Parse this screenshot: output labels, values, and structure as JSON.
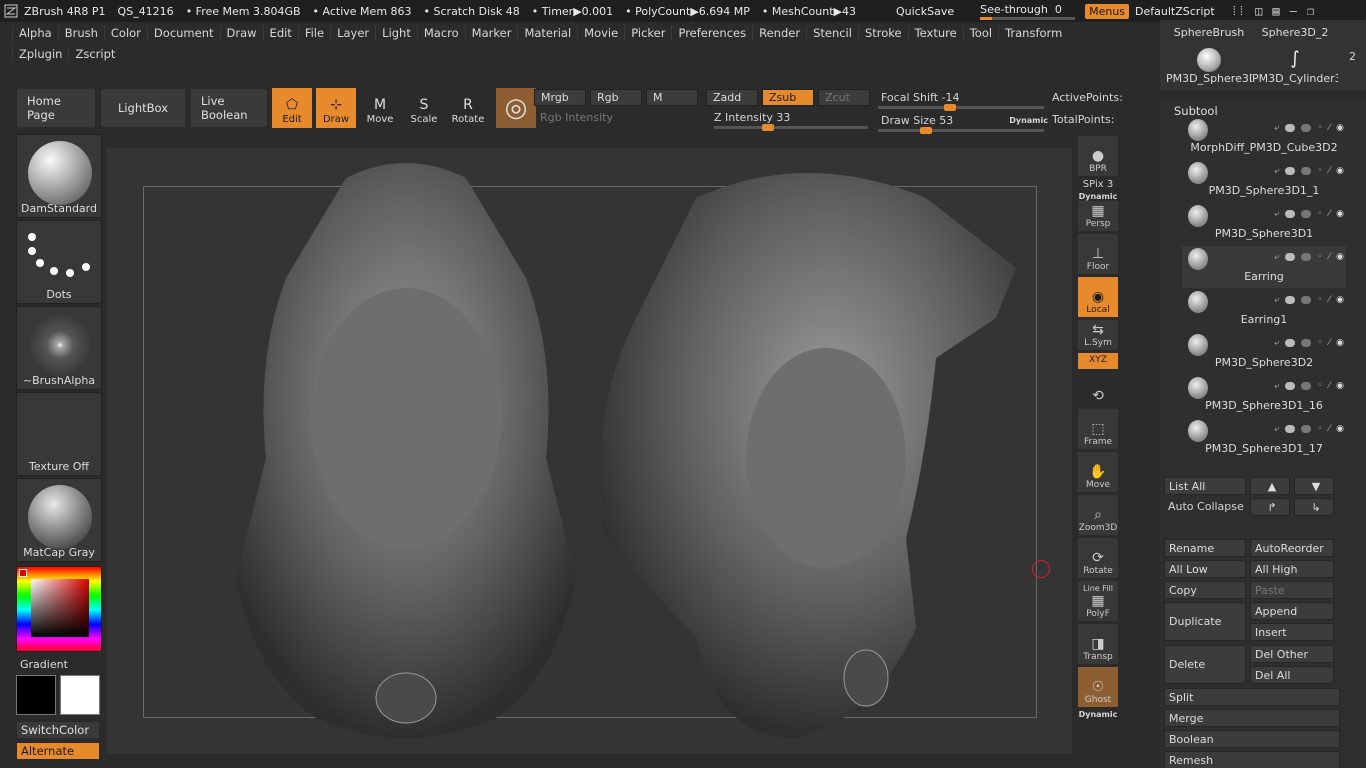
{
  "titlebar": {
    "app": "ZBrush 4R8 P1",
    "file": "QS_41216",
    "free_mem": "• Free Mem 3.804GB",
    "active_mem": "• Active Mem 863",
    "scratch": "• Scratch Disk 48",
    "timer": "• Timer▶0.001",
    "polycount": "• PolyCount▶6.694 MP",
    "meshcount": "• MeshCount▶43",
    "quicksave": "QuickSave",
    "see_through_label": "See-through",
    "see_through_value": "0",
    "see_through_level": 0,
    "menus": "Menus",
    "zscript": "DefaultZScript"
  },
  "menus": {
    "row1": [
      "Alpha",
      "Brush",
      "Color",
      "Document",
      "Draw",
      "Edit",
      "File",
      "Layer",
      "Light",
      "Macro",
      "Marker",
      "Material",
      "Movie",
      "Picker",
      "Preferences",
      "Render",
      "Stencil",
      "Stroke",
      "Texture",
      "Tool",
      "Transform"
    ],
    "row2": [
      "Zplugin",
      "Zscript"
    ]
  },
  "quickbar": {
    "home": "Home Page",
    "lightbox": "LightBox",
    "live_boolean": "Live Boolean",
    "edit": "Edit",
    "draw": "Draw",
    "move": "Move",
    "scale": "Scale",
    "rotate": "Rotate"
  },
  "params": {
    "mrgb": "Mrgb",
    "rgb": "Rgb",
    "m": "M",
    "rgb_intensity": "Rgb Intensity",
    "zadd": "Zadd",
    "zsub": "Zsub",
    "zcut": "Zcut",
    "z_intensity": "Z Intensity 33",
    "z_intensity_level": 0.33,
    "focal_shift": "Focal Shift -14",
    "focal_shift_level": 0.43,
    "draw_size": "Draw Size 53",
    "draw_size_level": 0.27,
    "dynamic": "Dynamic",
    "active_points": "ActivePoints:",
    "total_points": "TotalPoints:"
  },
  "leftshelf": {
    "brush": "DamStandard",
    "stroke": "Dots",
    "alpha": "~BrushAlpha",
    "texture": "Texture Off",
    "material": "MatCap Gray",
    "gradient": "Gradient",
    "switch_color": "SwitchColor",
    "alternate": "Alternate"
  },
  "rightshelf": {
    "bpr": "BPR",
    "spix": "SPix 3",
    "dynamic": "Dynamic",
    "persp": "Persp",
    "floor": "Floor",
    "local": "Local",
    "lsym": "L.Sym",
    "xyz": "XYZ",
    "frame": "Frame",
    "move": "Move",
    "zoom3d": "Zoom3D",
    "rotate": "Rotate",
    "line_fill": "Line Fill",
    "polyf": "PolyF",
    "transp": "Transp",
    "ghost": "Ghost",
    "dynamic2": "Dynamic"
  },
  "tools": {
    "t1": "SphereBrush",
    "t2": "Sphere3D_2",
    "t3": "PM3D_Sphere3D",
    "t4": "PM3D_Cylinder3",
    "badge": "2"
  },
  "subtool": {
    "title": "Subtool",
    "items": [
      "MorphDiff_PM3D_Cube3D2",
      "PM3D_Sphere3D1_1",
      "PM3D_Sphere3D1",
      "Earring",
      "Earring1",
      "PM3D_Sphere3D2",
      "PM3D_Sphere3D1_16",
      "PM3D_Sphere3D1_17"
    ],
    "list_all": "List All",
    "auto_collapse": "Auto Collapse",
    "rename": "Rename",
    "auto_reorder": "AutoReorder",
    "all_low": "All Low",
    "all_high": "All High",
    "copy": "Copy",
    "paste": "Paste",
    "duplicate": "Duplicate",
    "append": "Append",
    "insert": "Insert",
    "delete": "Delete",
    "del_other": "Del Other",
    "del_all": "Del All",
    "split": "Split",
    "merge": "Merge",
    "boolean": "Boolean",
    "remesh": "Remesh"
  },
  "colors": {
    "accent": "#e78a2c",
    "bg": "#2b2b2b",
    "viewport": "#343434"
  }
}
